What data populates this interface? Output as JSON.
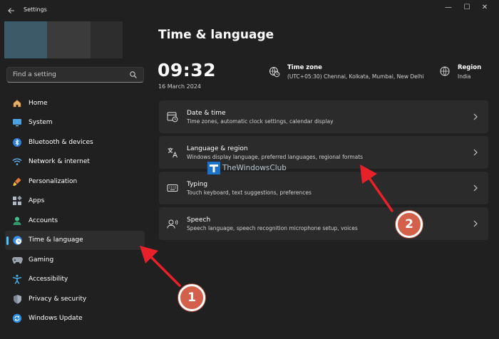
{
  "window": {
    "title": "Settings",
    "controls": {
      "minimize": "—",
      "maximize": "☐",
      "close": "✕"
    }
  },
  "search": {
    "placeholder": "Find a setting"
  },
  "sidebar": {
    "items": [
      {
        "label": "Home",
        "icon": "home-icon",
        "selected": false
      },
      {
        "label": "System",
        "icon": "system-icon",
        "selected": false
      },
      {
        "label": "Bluetooth & devices",
        "icon": "bluetooth-icon",
        "selected": false
      },
      {
        "label": "Network & internet",
        "icon": "wifi-icon",
        "selected": false
      },
      {
        "label": "Personalization",
        "icon": "brush-icon",
        "selected": false
      },
      {
        "label": "Apps",
        "icon": "apps-icon",
        "selected": false
      },
      {
        "label": "Accounts",
        "icon": "person-icon",
        "selected": false
      },
      {
        "label": "Time & language",
        "icon": "globe-clock-icon",
        "selected": true
      },
      {
        "label": "Gaming",
        "icon": "gamepad-icon",
        "selected": false
      },
      {
        "label": "Accessibility",
        "icon": "accessibility-icon",
        "selected": false
      },
      {
        "label": "Privacy & security",
        "icon": "shield-icon",
        "selected": false
      },
      {
        "label": "Windows Update",
        "icon": "update-icon",
        "selected": false
      }
    ]
  },
  "main": {
    "title": "Time & language",
    "clock": {
      "time": "09:32",
      "date": "16 March 2024"
    },
    "timezone": {
      "title": "Time zone",
      "value": "(UTC+05:30) Chennai, Kolkata, Mumbai, New Delhi"
    },
    "region": {
      "title": "Region",
      "value": "India"
    },
    "cards": [
      {
        "title": "Date & time",
        "desc": "Time zones, automatic clock settings, calendar display",
        "icon": "calendar-clock-icon"
      },
      {
        "title": "Language & region",
        "desc": "Windows display language, preferred languages, regional formats",
        "icon": "language-icon"
      },
      {
        "title": "Typing",
        "desc": "Touch keyboard, text suggestions, preferences",
        "icon": "keyboard-icon"
      },
      {
        "title": "Speech",
        "desc": "Speech language, speech recognition microphone setup, voices",
        "icon": "speech-icon"
      }
    ]
  },
  "watermark": {
    "text": "TheWindowsClub"
  },
  "annotations": {
    "badge1": "1",
    "badge2": "2",
    "color": "#d2604a",
    "arrow_color": "#e8202a"
  },
  "colors": {
    "background": "#202020",
    "card": "#2b2b2b",
    "accent": "#4cc2ff"
  }
}
